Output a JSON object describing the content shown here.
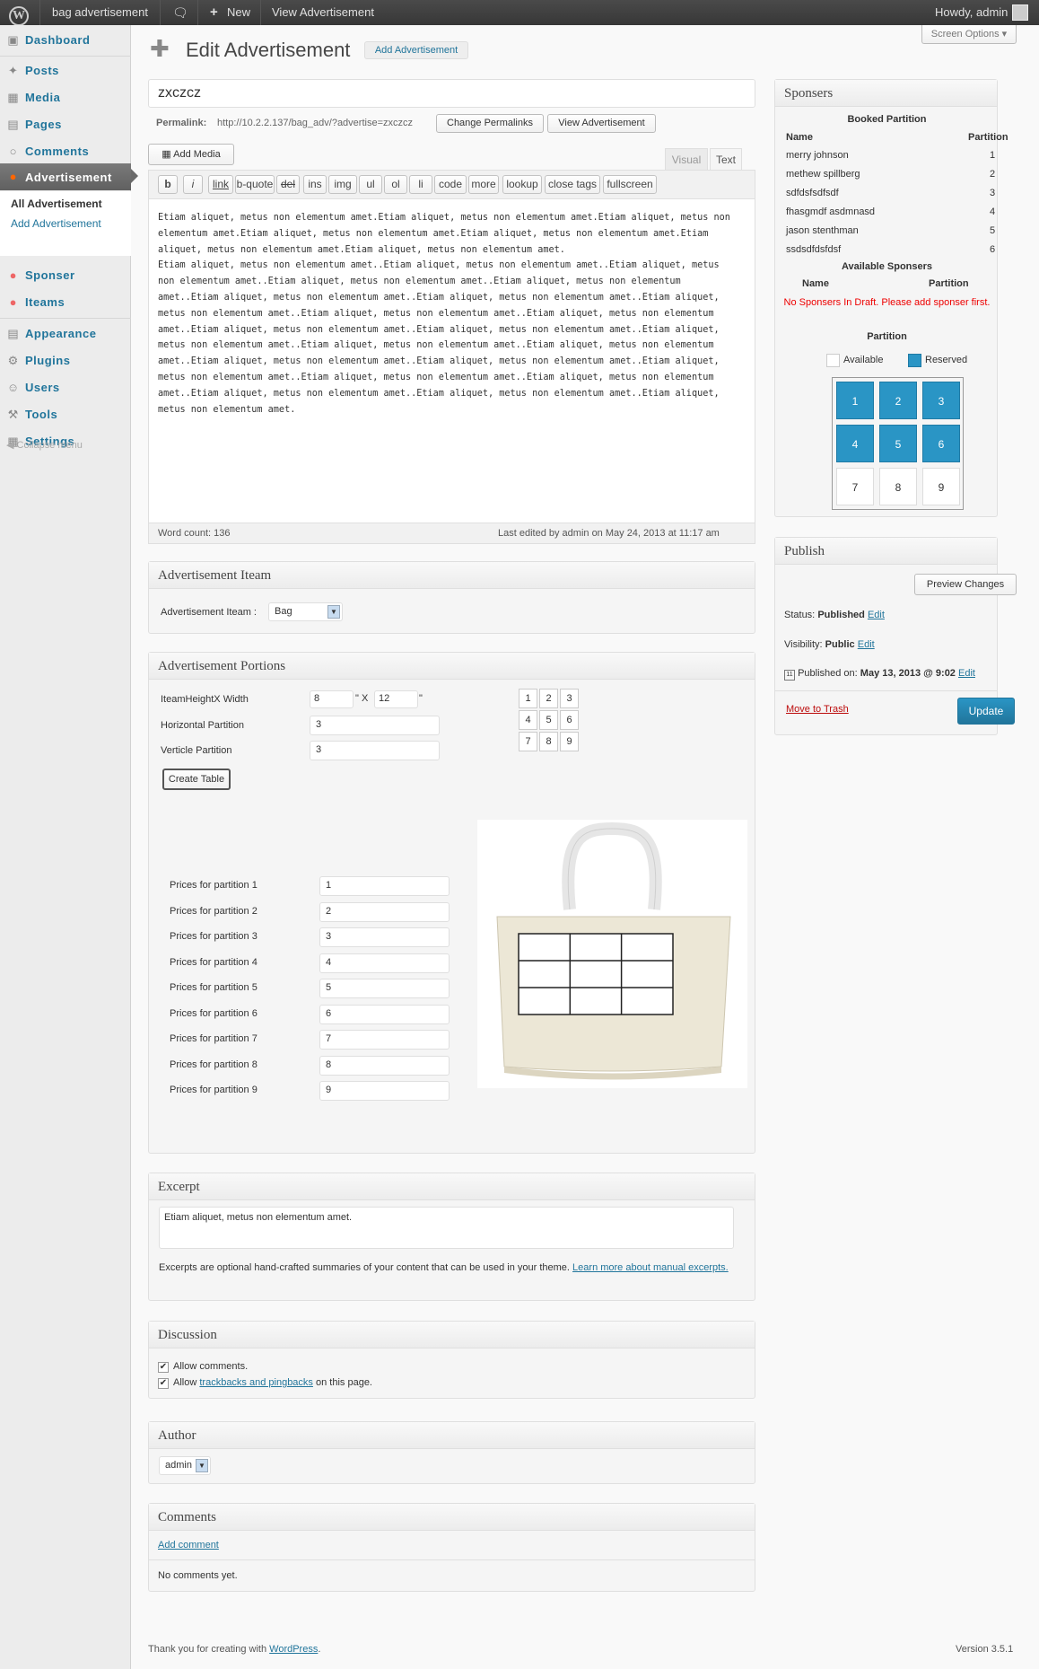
{
  "adminbar": {
    "site_name": "bag advertisement",
    "new_label": "New",
    "view_label": "View Advertisement",
    "howdy": "Howdy, admin"
  },
  "screen_options": "Screen Options",
  "sidebar": {
    "items": [
      {
        "label": "Dashboard",
        "icon": "dashboard-icon"
      },
      {
        "label": "Posts",
        "icon": "pin-icon"
      },
      {
        "label": "Media",
        "icon": "media-icon"
      },
      {
        "label": "Pages",
        "icon": "page-icon"
      },
      {
        "label": "Comments",
        "icon": "comment-icon"
      },
      {
        "label": "Advertisement",
        "icon": "ad-icon"
      },
      {
        "label": "Sponser",
        "icon": "sponser-icon"
      },
      {
        "label": "Iteams",
        "icon": "iteams-icon"
      },
      {
        "label": "Appearance",
        "icon": "appearance-icon"
      },
      {
        "label": "Plugins",
        "icon": "plugin-icon"
      },
      {
        "label": "Users",
        "icon": "users-icon"
      },
      {
        "label": "Tools",
        "icon": "tools-icon"
      },
      {
        "label": "Settings",
        "icon": "settings-icon"
      }
    ],
    "submenu": [
      "All Advertisement",
      "Add Advertisement"
    ],
    "collapse": "Collapse menu"
  },
  "page": {
    "title": "Edit Advertisement",
    "add_new": "Add Advertisement",
    "post_title": "zxczcz",
    "permalink_label": "Permalink:",
    "permalink_url": "http://10.2.2.137/bag_adv/?advertise=zxczcz",
    "change_permalinks": "Change Permalinks",
    "view_advertisement": "View Advertisement",
    "add_media": "Add Media",
    "tab_visual": "Visual",
    "tab_text": "Text"
  },
  "quicktags": [
    "b",
    "i",
    "link",
    "b-quote",
    "del",
    "ins",
    "img",
    "ul",
    "ol",
    "li",
    "code",
    "more",
    "lookup",
    "close tags",
    "fullscreen"
  ],
  "editor": {
    "content": "Etiam aliquet, metus non elementum amet.Etiam aliquet, metus non elementum amet.Etiam aliquet, metus non elementum amet.Etiam aliquet, metus non elementum amet.Etiam aliquet, metus non elementum amet.Etiam aliquet, metus non elementum amet.Etiam aliquet, metus non elementum amet.\nEtiam aliquet, metus non elementum amet..Etiam aliquet, metus non elementum amet..Etiam aliquet, metus non elementum amet..Etiam aliquet, metus non elementum amet..Etiam aliquet, metus non elementum amet..Etiam aliquet, metus non elementum amet..Etiam aliquet, metus non elementum amet..Etiam aliquet, metus non elementum amet..Etiam aliquet, metus non elementum amet..Etiam aliquet, metus non elementum amet..Etiam aliquet, metus non elementum amet..Etiam aliquet, metus non elementum amet..Etiam aliquet, metus non elementum amet..Etiam aliquet, metus non elementum amet..Etiam aliquet, metus non elementum amet..Etiam aliquet, metus non elementum amet..Etiam aliquet, metus non elementum amet..Etiam aliquet, metus non elementum amet..Etiam aliquet, metus non elementum amet..Etiam aliquet, metus non elementum amet..Etiam aliquet, metus non elementum amet..Etiam aliquet, metus non elementum amet..Etiam aliquet, metus non elementum amet.",
    "word_count": "Word count: 136",
    "last_edited": "Last edited by admin on May 24, 2013 at 11:17 am"
  },
  "item_box": {
    "title": "Advertisement Iteam",
    "label": "Advertisement Iteam :",
    "selected": "Bag"
  },
  "portions_box": {
    "title": "Advertisement Portions",
    "hw_label": "IteamHeightX Width",
    "height": "8",
    "x_sep": "\" X",
    "width": "12",
    "quote": "\"",
    "hpart_label": "Horizontal Partition",
    "hpart": "3",
    "vpart_label": "Verticle Partition",
    "vpart": "3",
    "create_table": "Create Table",
    "grid": [
      "1",
      "2",
      "3",
      "4",
      "5",
      "6",
      "7",
      "8",
      "9"
    ],
    "prices": [
      {
        "label": "Prices for partition 1",
        "value": "1"
      },
      {
        "label": "Prices for partition 2",
        "value": "2"
      },
      {
        "label": "Prices for partition 3",
        "value": "3"
      },
      {
        "label": "Prices for partition 4",
        "value": "4"
      },
      {
        "label": "Prices for partition 5",
        "value": "5"
      },
      {
        "label": "Prices for partition 6",
        "value": "6"
      },
      {
        "label": "Prices for partition 7",
        "value": "7"
      },
      {
        "label": "Prices for partition 8",
        "value": "8"
      },
      {
        "label": "Prices for partition 9",
        "value": "9"
      }
    ]
  },
  "excerpt_box": {
    "title": "Excerpt",
    "value": "Etiam aliquet, metus non elementum amet.",
    "help_text": "Excerpts are optional hand-crafted summaries of your content that can be used in your theme.",
    "help_link": "Learn more about manual excerpts."
  },
  "discussion_box": {
    "title": "Discussion",
    "allow_comments": "Allow comments.",
    "allow_prefix": "Allow",
    "trackbacks_link": "trackbacks and pingbacks",
    "allow_suffix": "on this page."
  },
  "author_box": {
    "title": "Author",
    "selected": "admin"
  },
  "comments_box": {
    "title": "Comments",
    "add_comment": "Add comment",
    "no_comments": "No comments yet."
  },
  "sponsers_box": {
    "title": "Sponsers",
    "booked_title": "Booked Partition",
    "col_name": "Name",
    "col_partition": "Partition",
    "booked": [
      {
        "name": "merry johnson",
        "partition": "1"
      },
      {
        "name": "methew spillberg",
        "partition": "2"
      },
      {
        "name": "sdfdsfsdfsdf",
        "partition": "3"
      },
      {
        "name": "fhasgmdf asdmnasd",
        "partition": "4"
      },
      {
        "name": "jason stenthman",
        "partition": "5"
      },
      {
        "name": "ssdsdfdsfdsf",
        "partition": "6"
      }
    ],
    "available_title": "Available Sponsers",
    "avail_col_name": "Name",
    "avail_col_partition": "Partition",
    "no_sponsers": "No Sponsers In Draft. Please add sponser first.",
    "partition_title": "Partition",
    "legend_available": "Available",
    "legend_reserved": "Reserved",
    "cells": [
      {
        "n": "1",
        "status": "reserved"
      },
      {
        "n": "2",
        "status": "reserved"
      },
      {
        "n": "3",
        "status": "reserved"
      },
      {
        "n": "4",
        "status": "reserved"
      },
      {
        "n": "5",
        "status": "reserved"
      },
      {
        "n": "6",
        "status": "reserved"
      },
      {
        "n": "7",
        "status": "available"
      },
      {
        "n": "8",
        "status": "available"
      },
      {
        "n": "9",
        "status": "available"
      }
    ],
    "colors": {
      "reserved": "#2a95c5",
      "available": "#ffffff"
    }
  },
  "publish_box": {
    "title": "Publish",
    "preview": "Preview Changes",
    "status_label": "Status:",
    "status": "Published",
    "visibility_label": "Visibility:",
    "visibility": "Public",
    "published_label": "Published on:",
    "published_on": "May 13, 2013 @ 9:02",
    "edit": "Edit",
    "trash": "Move to Trash",
    "update": "Update"
  },
  "footer": {
    "thanks": "Thank you for creating with",
    "wp_link": "WordPress",
    "version": "Version 3.5.1"
  }
}
